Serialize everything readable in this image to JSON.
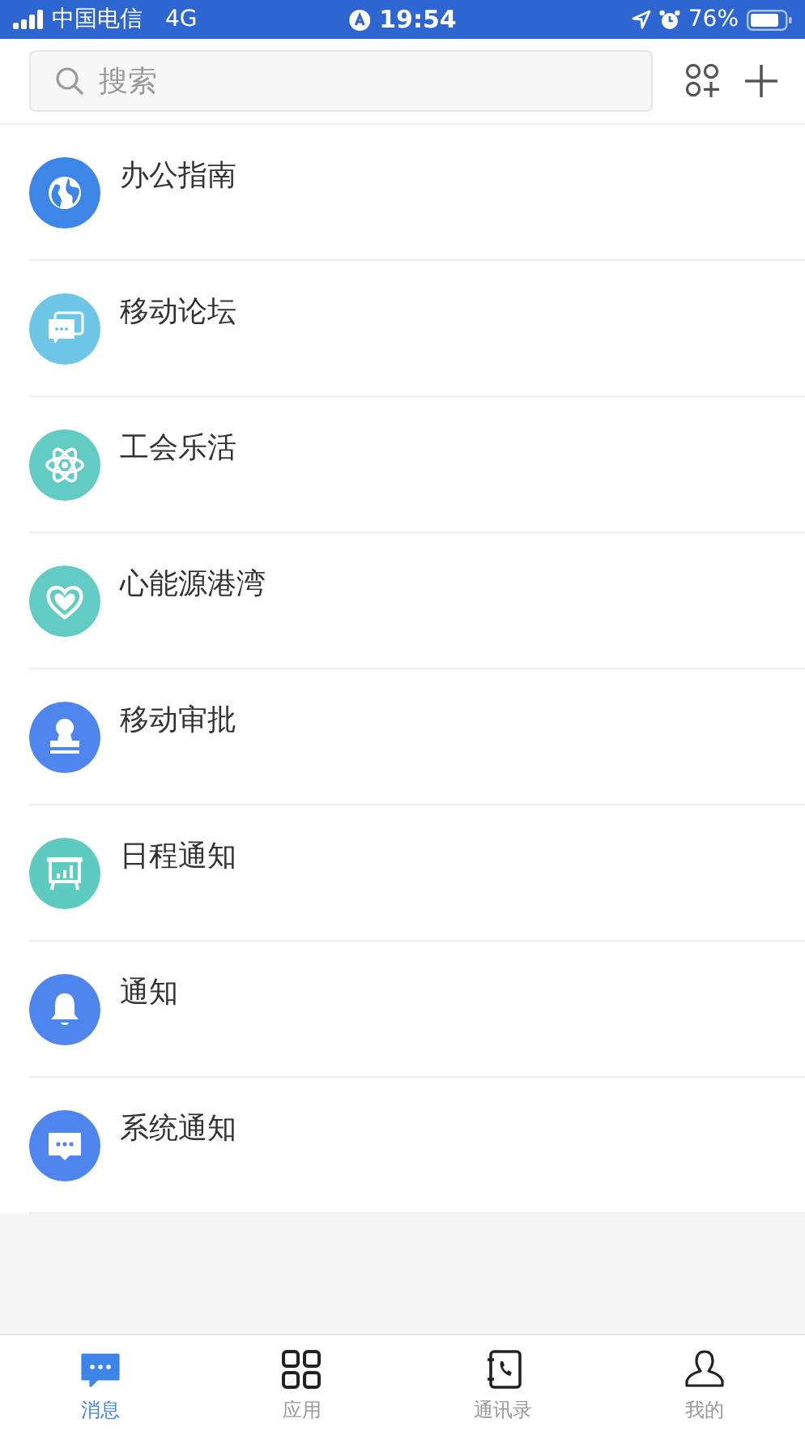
{
  "status_bar": {
    "carrier": "中国电信",
    "network": "4G",
    "time": "19:54",
    "battery": "76%"
  },
  "search": {
    "placeholder": "搜索"
  },
  "items": [
    {
      "kind": "globe",
      "title": "办公指南",
      "color": "#3d85e6"
    },
    {
      "kind": "forum",
      "title": "移动论坛",
      "color": "#6ec6e6"
    },
    {
      "kind": "atom",
      "title": "工会乐活",
      "color": "#62cbc4"
    },
    {
      "kind": "heart",
      "title": "心能源港湾",
      "color": "#62cbc4"
    },
    {
      "kind": "stamp",
      "title": "移动审批",
      "color": "#4f86ee"
    },
    {
      "kind": "board",
      "title": "日程通知",
      "color": "#5ecbc0"
    },
    {
      "kind": "bell",
      "title": "通知",
      "color": "#4f86ee"
    },
    {
      "kind": "chat",
      "title": "系统通知",
      "color": "#4f86ee"
    }
  ],
  "tabs": [
    {
      "kind": "chat",
      "label": "消息",
      "selected": true
    },
    {
      "kind": "apps",
      "label": "应用",
      "selected": false
    },
    {
      "kind": "contacts",
      "label": "通讯录",
      "selected": false
    },
    {
      "kind": "person",
      "label": "我的",
      "selected": false
    }
  ]
}
